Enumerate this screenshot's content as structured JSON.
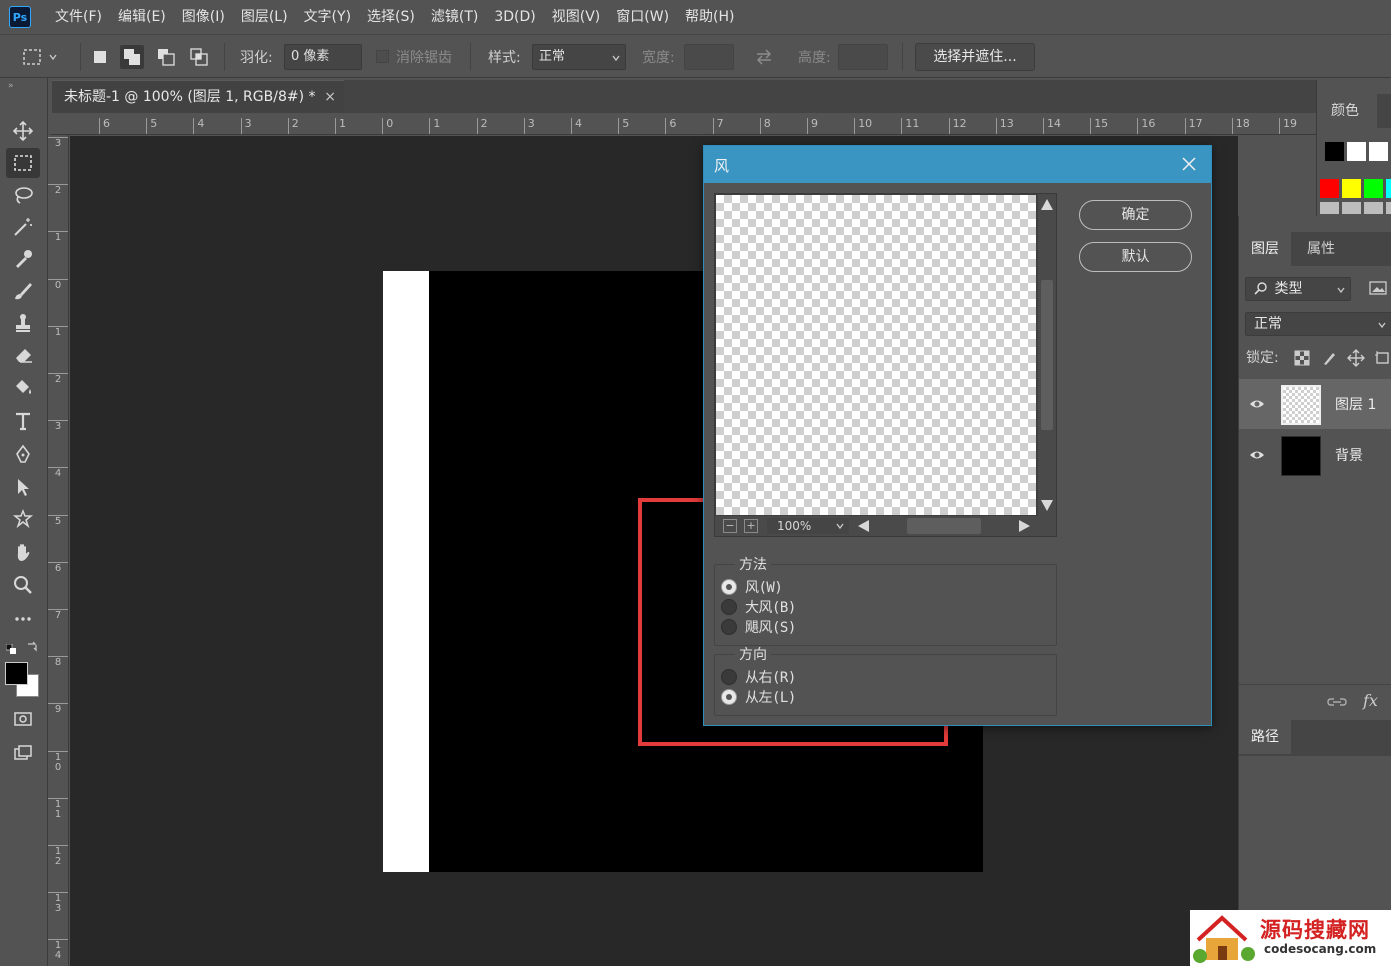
{
  "app": {
    "logo": "Ps"
  },
  "menubar": {
    "items": [
      "文件(F)",
      "编辑(E)",
      "图像(I)",
      "图层(L)",
      "文字(Y)",
      "选择(S)",
      "滤镜(T)",
      "3D(D)",
      "视图(V)",
      "窗口(W)",
      "帮助(H)"
    ]
  },
  "options": {
    "feather_label": "羽化:",
    "feather_value": "0 像素",
    "antialias_label": "消除锯齿",
    "style_label": "样式:",
    "style_value": "正常",
    "width_label": "宽度:",
    "height_label": "高度:",
    "select_mask_label": "选择并遮住..."
  },
  "document": {
    "tab_title": "未标题-1 @ 100% (图层 1, RGB/8#) *",
    "tab_close": "×"
  },
  "rulers": {
    "horizontal": [
      "6",
      "5",
      "4",
      "3",
      "2",
      "1",
      "0",
      "1",
      "2",
      "3",
      "4",
      "5",
      "6",
      "7",
      "8",
      "9",
      "10",
      "11",
      "12",
      "13",
      "14",
      "15",
      "16",
      "17",
      "18",
      "19"
    ],
    "vertical": [
      "3",
      "2",
      "1",
      "0",
      "1",
      "2",
      "3",
      "4",
      "5",
      "6",
      "7",
      "8",
      "9",
      "1\n0",
      "1\n1",
      "1\n2",
      "1\n3",
      "1\n4"
    ]
  },
  "dialog": {
    "title": "风",
    "ok_label": "确定",
    "default_label": "默认",
    "zoom": "100%",
    "method": {
      "legend": "方法",
      "options": [
        "风(W)",
        "大风(B)",
        "飓风(S)"
      ],
      "selected": "风(W)"
    },
    "direction": {
      "legend": "方向",
      "options": [
        "从右(R)",
        "从左(L)"
      ],
      "selected": "从左(L)"
    }
  },
  "panels": {
    "color_tab": "颜色",
    "swatches_row1": [
      "#000000",
      "#ffffff",
      "#ffffff"
    ],
    "swatches_row2": [
      "#ff0000",
      "#ffff00",
      "#00ff00",
      "#00ffff"
    ],
    "layers_tab": "图层",
    "properties_tab": "属性",
    "filter_kind": "类型",
    "blend_mode": "正常",
    "lock_label": "锁定:",
    "layers": [
      {
        "name": "图层 1",
        "selected": true,
        "thumb": "transparent"
      },
      {
        "name": "背景",
        "selected": false,
        "thumb": "black"
      }
    ],
    "paths_tab": "路径"
  },
  "watermark": {
    "title": "源码搜藏网",
    "url": "codesocang.com"
  },
  "colors": {
    "dialog_title_bg": "#3a95c3",
    "highlight": "#e33b3b",
    "canvas_bg": "#282828"
  }
}
